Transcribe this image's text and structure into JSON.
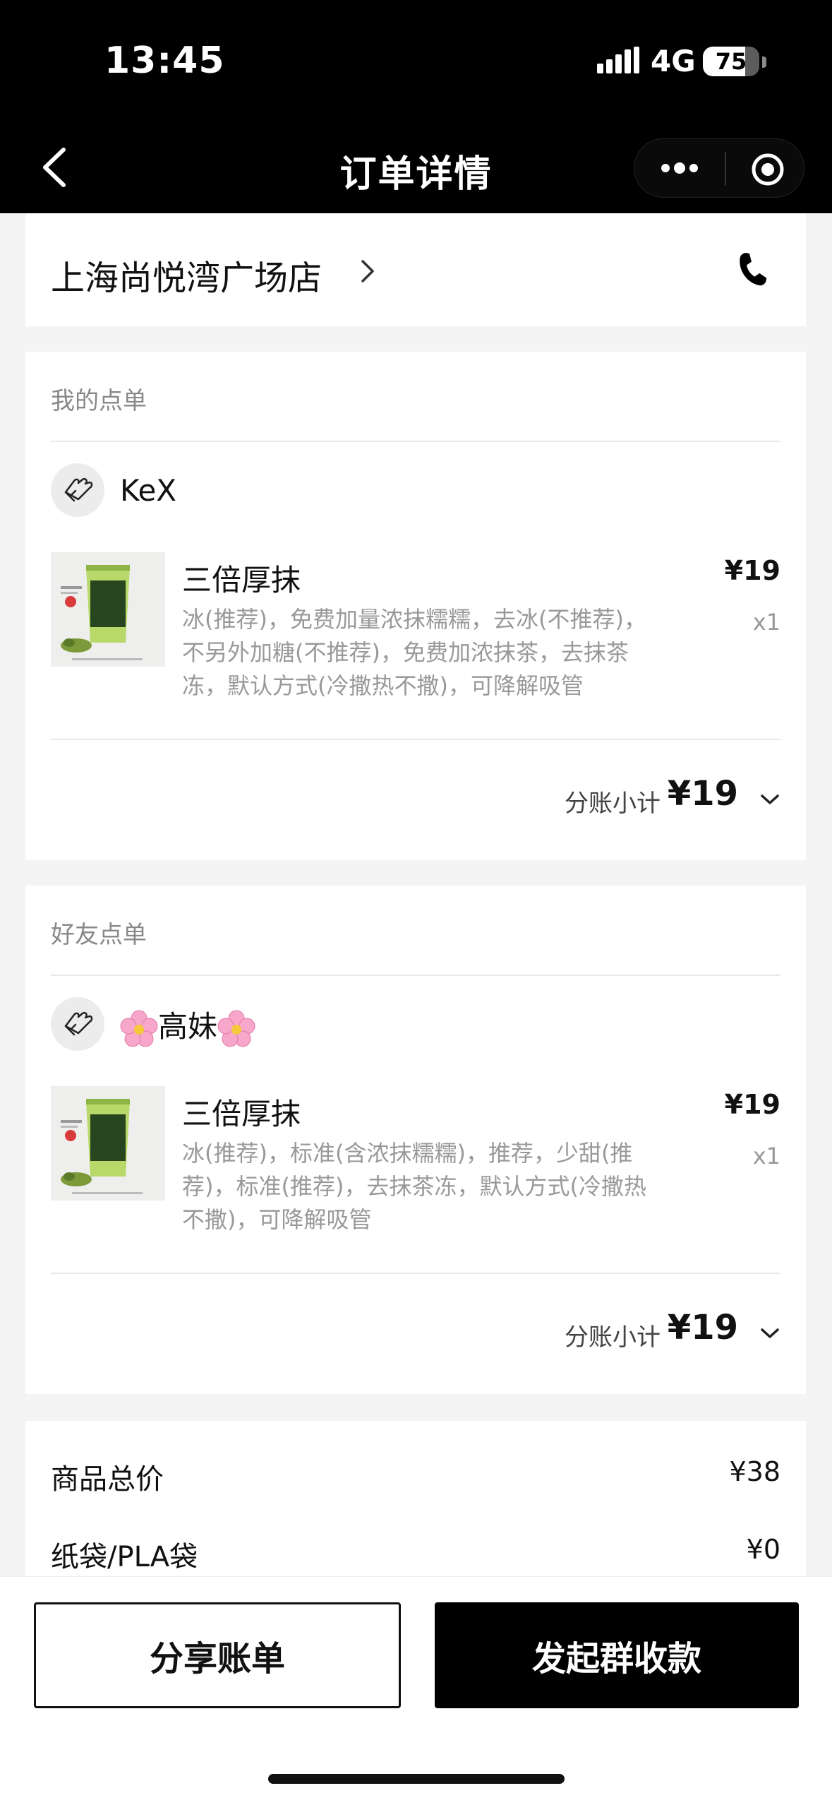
{
  "status": {
    "time": "13:45",
    "network": "4G",
    "battery": "75",
    "battery_level": 0.75
  },
  "nav": {
    "title": "订单详情",
    "back_icon": "chevron-left-icon",
    "more_icon": "more-dots-icon",
    "close_icon": "target-circle-icon"
  },
  "store": {
    "name": "上海尚悦湾广场店",
    "phone_icon": "phone-icon"
  },
  "my_order": {
    "heading": "我的点单",
    "user": "KeX",
    "item": {
      "name": "三倍厚抹",
      "spec": "冰(推荐)，免费加量浓抹糯糯，去冰(不推荐)，不另外加糖(不推荐)，免费加浓抹茶，去抹茶冻，默认方式(冷撒热不撒)，可降解吸管",
      "price": "¥19",
      "qty": "x1"
    },
    "subtotal_label": "分账小计",
    "subtotal": "¥19"
  },
  "friend_order": {
    "heading": "好友点单",
    "user": "高妹",
    "item": {
      "name": "三倍厚抹",
      "spec": "冰(推荐)，标准(含浓抹糯糯)，推荐，少甜(推荐)，标准(推荐)，去抹茶冻，默认方式(冷撒热不撒)，可降解吸管",
      "price": "¥19",
      "qty": "x1"
    },
    "subtotal_label": "分账小计",
    "subtotal": "¥19"
  },
  "summary": {
    "goods_total_label": "商品总价",
    "goods_total": "¥38",
    "bag_label": "纸袋/PLA袋",
    "bag_price": "¥0"
  },
  "actions": {
    "share": "分享账单",
    "collect": "发起群收款"
  }
}
